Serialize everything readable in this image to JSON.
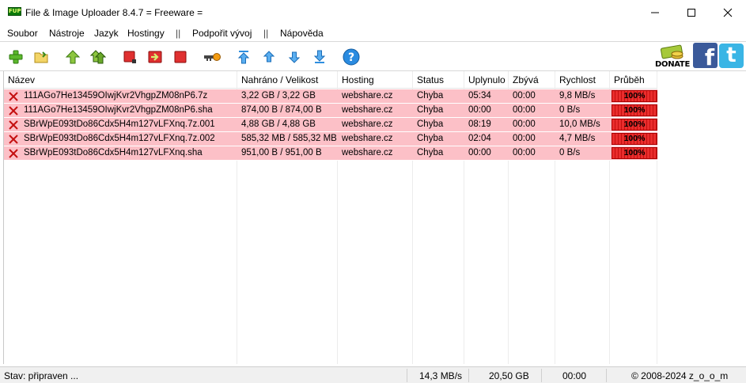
{
  "window": {
    "app_icon_text": "FUP",
    "title": "File & Image Uploader 8.4.7  = Freeware ="
  },
  "menu": [
    {
      "label": "Soubor"
    },
    {
      "label": "Nástroje"
    },
    {
      "label": "Jazyk"
    },
    {
      "label": "Hostingy"
    },
    {
      "label": "||"
    },
    {
      "label": "Podpořit vývoj"
    },
    {
      "label": "||"
    },
    {
      "label": "Nápověda"
    }
  ],
  "toolbar": {
    "icons": [
      "add-icon",
      "open-folder-icon",
      "upload-icon",
      "upload-all-icon",
      "stop-icon",
      "export-icon",
      "stop-all-icon",
      "key-icon",
      "move-top-icon",
      "move-up-icon",
      "move-down-icon",
      "move-bottom-icon",
      "help-icon"
    ],
    "donate_label": "DONATE",
    "facebook_letter": "f",
    "twitter_letter": "t"
  },
  "table": {
    "columns": [
      "Název",
      "Nahráno / Velikost",
      "Hosting",
      "Status",
      "Uplynulo",
      "Zbývá",
      "Rychlost",
      "Průběh"
    ],
    "rows": [
      {
        "name": "111AGo7He13459OIwjKvr2VhgpZM08nP6.7z",
        "size": "3,22 GB / 3,22 GB",
        "hosting": "webshare.cz",
        "status": "Chyba",
        "elapsed": "05:34",
        "remaining": "00:00",
        "speed": "9,8 MB/s",
        "progress": "100%",
        "progress_value": 1.0
      },
      {
        "name": "111AGo7He13459OIwjKvr2VhgpZM08nP6.sha",
        "size": "874,00 B / 874,00 B",
        "hosting": "webshare.cz",
        "status": "Chyba",
        "elapsed": "00:00",
        "remaining": "00:00",
        "speed": "0 B/s",
        "progress": "100%",
        "progress_value": 1.0
      },
      {
        "name": "SBrWpE093tDo86Cdx5H4m127vLFXnq.7z.001",
        "size": "4,88 GB / 4,88 GB",
        "hosting": "webshare.cz",
        "status": "Chyba",
        "elapsed": "08:19",
        "remaining": "00:00",
        "speed": "10,0 MB/s",
        "progress": "100%",
        "progress_value": 1.0
      },
      {
        "name": "SBrWpE093tDo86Cdx5H4m127vLFXnq.7z.002",
        "size": "585,32 MB / 585,32 MB",
        "hosting": "webshare.cz",
        "status": "Chyba",
        "elapsed": "02:04",
        "remaining": "00:00",
        "speed": "4,7 MB/s",
        "progress": "100%",
        "progress_value": 1.0
      },
      {
        "name": "SBrWpE093tDo86Cdx5H4m127vLFXnq.sha",
        "size": "951,00 B / 951,00 B",
        "hosting": "webshare.cz",
        "status": "Chyba",
        "elapsed": "00:00",
        "remaining": "00:00",
        "speed": "0 B/s",
        "progress": "100%",
        "progress_value": 1.0
      }
    ]
  },
  "status": {
    "state": "Stav: připraven ...",
    "speed": "14,3 MB/s",
    "total": "20,50 GB",
    "time": "00:00",
    "copyright": "© 2008-2024 z_o_o_m"
  },
  "colors": {
    "row_error": "#fcc0c7",
    "progress": "#ea2d2d"
  }
}
